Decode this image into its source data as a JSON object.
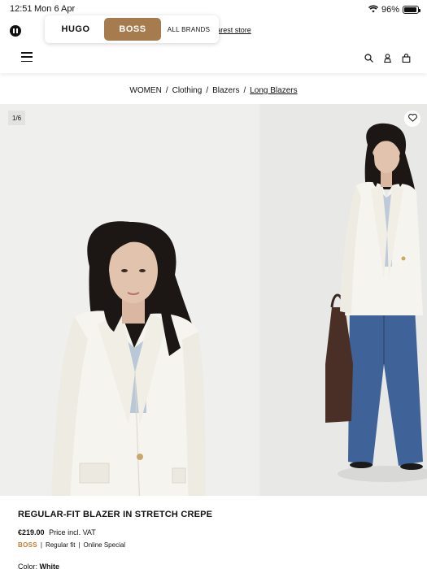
{
  "status_bar": {
    "time": "12:51",
    "date": "Mon 6 Apr",
    "battery": "96%",
    "battery_level": 0.96
  },
  "promo": {
    "store_link": "Find your nearest store"
  },
  "header": {
    "brands": {
      "hugo": "HUGO",
      "boss": "BOSS",
      "all": "ALL BRANDS"
    },
    "active_brand_color": "#a67b4e",
    "icons": [
      "menu-icon",
      "search-icon",
      "account-icon",
      "bag-icon"
    ]
  },
  "breadcrumb": {
    "items": [
      "WOMEN",
      "Clothing",
      "Blazers",
      "Long Blazers"
    ],
    "separator": "/"
  },
  "gallery": {
    "counter": "1/6",
    "icons": [
      "heart-icon"
    ]
  },
  "product": {
    "title": "REGULAR-FIT BLAZER IN STRETCH CREPE",
    "price": "€219.00",
    "price_note": "Price incl. VAT",
    "brand_tag": "BOSS",
    "brand_tag_color": "#c97a2b",
    "fit": "Regular fit",
    "special": "Online Special",
    "color_label": "Color:",
    "color_value": "White"
  }
}
